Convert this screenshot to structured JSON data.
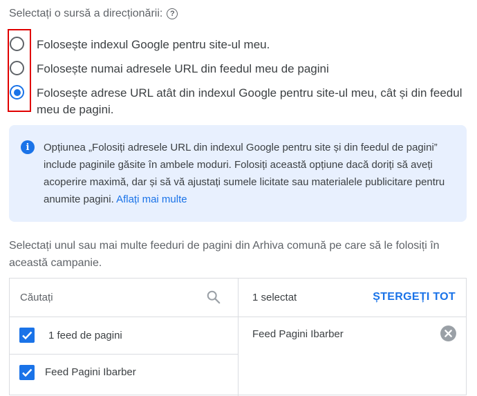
{
  "heading": "Selectați o sursă a direcționării:",
  "help_icon": "help-circle-icon",
  "options": [
    {
      "label": "Folosește indexul Google pentru site-ul meu.",
      "selected": false
    },
    {
      "label": "Folosește numai adresele URL din feedul meu de pagini",
      "selected": false
    },
    {
      "label": "Folosește adrese URL atât din indexul Google pentru site-ul meu, cât și din feedul meu de pagini.",
      "selected": true
    }
  ],
  "info": {
    "icon": "info-icon",
    "text": "Opțiunea „Folosiți adresele URL din indexul Google pentru site și din feedul de pagini” include paginile găsite în ambele moduri. Folosiți această opțiune dacă doriți să aveți acoperire maximă, dar și să vă ajustați sumele licitate sau materialele publicitare pentru anumite pagini.",
    "link": "Aflați mai multe"
  },
  "feeds_prompt": "Selectați unul sau mai multe feeduri de pagini din Arhiva comună pe care să le folosiți în această campanie.",
  "search": {
    "placeholder": "Căutați",
    "icon": "search-icon"
  },
  "list": {
    "group_label": "1 feed de pagini",
    "items": [
      {
        "label": "Feed Pagini Ibarber",
        "checked": true
      }
    ]
  },
  "selected_panel": {
    "count": "1 selectat",
    "clear_all": "ȘTERGEȚI TOT",
    "items": [
      {
        "label": "Feed Pagini Ibarber"
      }
    ]
  },
  "colors": {
    "accent": "#1a73e8",
    "info_bg": "#e8f0fe",
    "highlight": "#e00000"
  }
}
